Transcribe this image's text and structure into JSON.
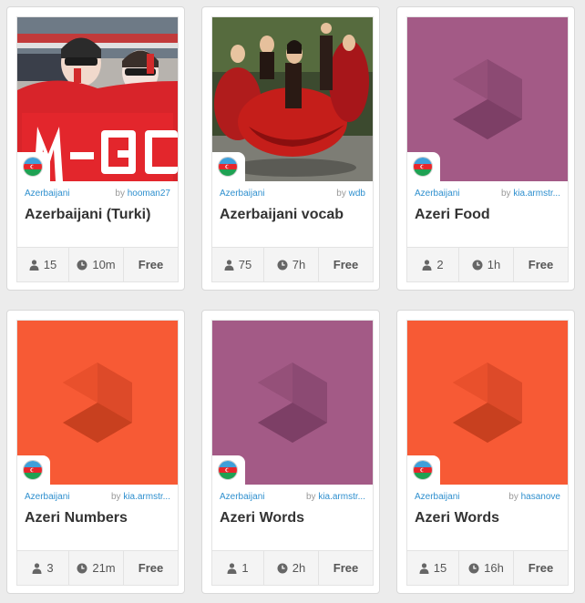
{
  "colors": {
    "link_blue": "#2e8fce",
    "purple_tile": "#a35a86",
    "orange_tile": "#f75a35"
  },
  "courses": [
    {
      "image": "photo-fans-red-scarves",
      "language": "Azerbaijani",
      "by": "by",
      "author": "hooman27",
      "title": "Azerbaijani (Turki)",
      "learners": "15",
      "time": "10m",
      "price": "Free"
    },
    {
      "image": "photo-dancers-red-dresses",
      "language": "Azerbaijani",
      "by": "by",
      "author": "wdb",
      "title": "Azerbaijani vocab",
      "learners": "75",
      "time": "7h",
      "price": "Free"
    },
    {
      "image": "memrise-logo-purple",
      "language": "Azerbaijani",
      "by": "by",
      "author": "kia.armstr...",
      "title": "Azeri Food",
      "learners": "2",
      "time": "1h",
      "price": "Free"
    },
    {
      "image": "memrise-logo-orange",
      "language": "Azerbaijani",
      "by": "by",
      "author": "kia.armstr...",
      "title": "Azeri Numbers",
      "learners": "3",
      "time": "21m",
      "price": "Free"
    },
    {
      "image": "memrise-logo-purple",
      "language": "Azerbaijani",
      "by": "by",
      "author": "kia.armstr...",
      "title": "Azeri Words",
      "learners": "1",
      "time": "2h",
      "price": "Free"
    },
    {
      "image": "memrise-logo-orange",
      "language": "Azerbaijani",
      "by": "by",
      "author": "hasanove",
      "title": "Azeri Words",
      "learners": "15",
      "time": "16h",
      "price": "Free"
    }
  ]
}
